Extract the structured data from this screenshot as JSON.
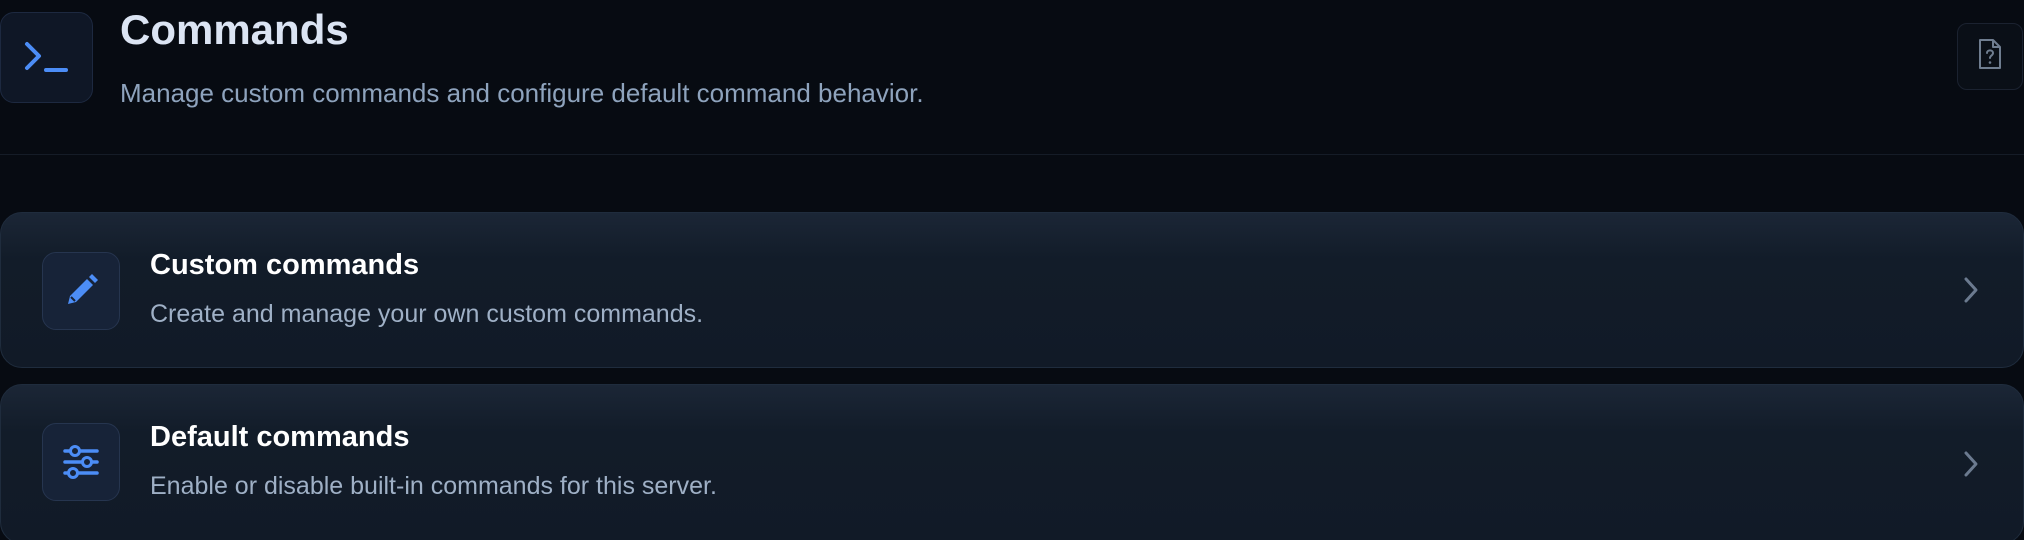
{
  "header": {
    "icon": "terminal-icon",
    "title": "Commands",
    "subtitle": "Manage custom commands and configure default command behavior.",
    "help_icon": "help-document-icon"
  },
  "cards": [
    {
      "icon": "pencil-icon",
      "title": "Custom commands",
      "description": "Create and manage your own custom commands.",
      "chevron_icon": "chevron-right-icon"
    },
    {
      "icon": "sliders-icon",
      "title": "Default commands",
      "description": "Enable or disable built-in commands for this server.",
      "chevron_icon": "chevron-right-icon"
    }
  ],
  "colors": {
    "background": "#070b12",
    "accent": "#4c8df6",
    "title_text": "#dbe4f3",
    "muted_text": "#8ea3bd",
    "card_background": "#121c29"
  }
}
